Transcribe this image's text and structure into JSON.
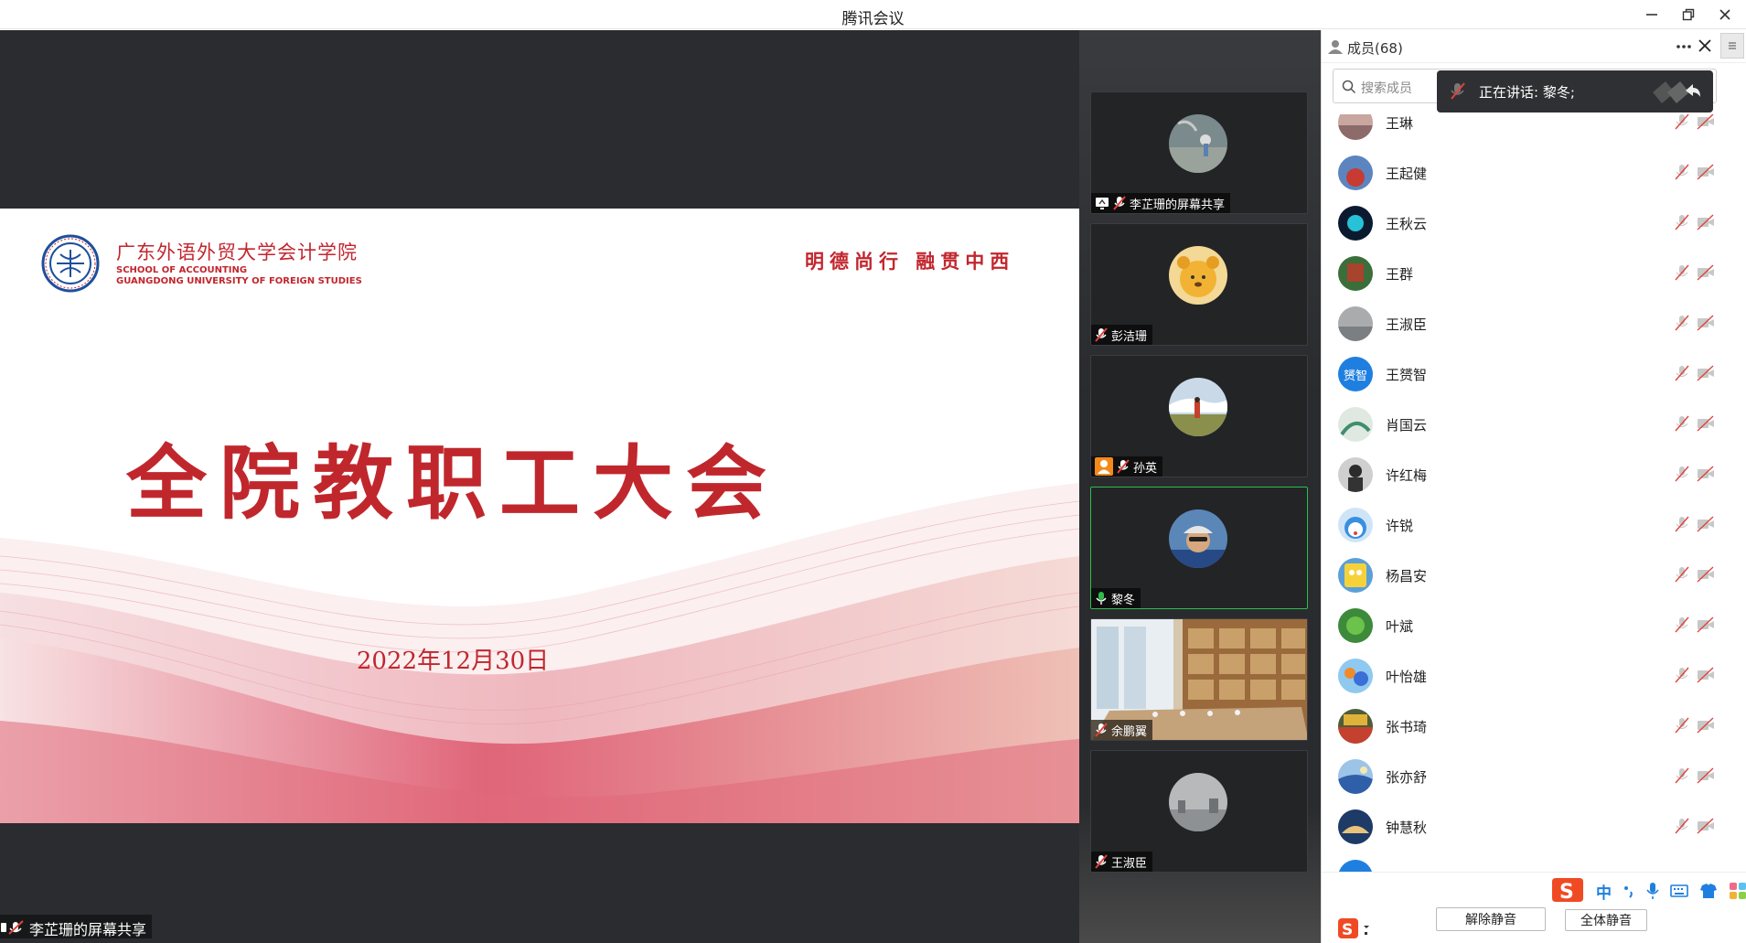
{
  "window": {
    "title": "腾讯会议",
    "colors": {
      "accent": "#2dbd4e",
      "slide_red": "#c0272d",
      "stage_bg": "#2b2c2f"
    }
  },
  "slide": {
    "school_cn": "广东外语外贸大学会计学院",
    "school_en_line1": "SCHOOL OF ACCOUNTING",
    "school_en_line2": "GUANGDONG UNIVERSITY OF FOREIGN STUDIES",
    "motto": "明德尚行 融贯中西",
    "headline": "全院教职工大会",
    "date": "2022年12月30日"
  },
  "stage": {
    "share_label": "李芷珊的屏幕共享"
  },
  "tiles": [
    {
      "name": "李芷珊的屏幕共享",
      "icon": "screen-share-icon",
      "mic": "muted",
      "active": false
    },
    {
      "name": "彭洁珊",
      "icon": "",
      "mic": "muted",
      "active": false
    },
    {
      "name": "孙英",
      "icon": "user-icon",
      "mic": "muted",
      "active": false
    },
    {
      "name": "黎冬",
      "icon": "",
      "mic": "on",
      "active": true
    },
    {
      "name": "余鹏翼",
      "icon": "",
      "mic": "muted",
      "active": false
    },
    {
      "name": "王淑臣",
      "icon": "",
      "mic": "muted",
      "active": false
    }
  ],
  "panel": {
    "title": "成员(68)",
    "search_placeholder": "搜索成员",
    "speaking_text": "正在讲话: 黎冬;",
    "members": [
      {
        "name": "王琳",
        "avatar_text": ""
      },
      {
        "name": "王起健",
        "avatar_text": ""
      },
      {
        "name": "王秋云",
        "avatar_text": ""
      },
      {
        "name": "王群",
        "avatar_text": ""
      },
      {
        "name": "王淑臣",
        "avatar_text": ""
      },
      {
        "name": "王赟智",
        "avatar_text": "赟智"
      },
      {
        "name": "肖国云",
        "avatar_text": ""
      },
      {
        "name": "许红梅",
        "avatar_text": ""
      },
      {
        "name": "许锐",
        "avatar_text": ""
      },
      {
        "name": "杨昌安",
        "avatar_text": ""
      },
      {
        "name": "叶斌",
        "avatar_text": ""
      },
      {
        "name": "叶怡雄",
        "avatar_text": ""
      },
      {
        "name": "张书琦",
        "avatar_text": ""
      },
      {
        "name": "张亦舒",
        "avatar_text": ""
      },
      {
        "name": "钟慧秋",
        "avatar_text": ""
      }
    ],
    "unmute_label": "解除静音",
    "mute_all_label": "全体静音",
    "ime_label": "中"
  }
}
